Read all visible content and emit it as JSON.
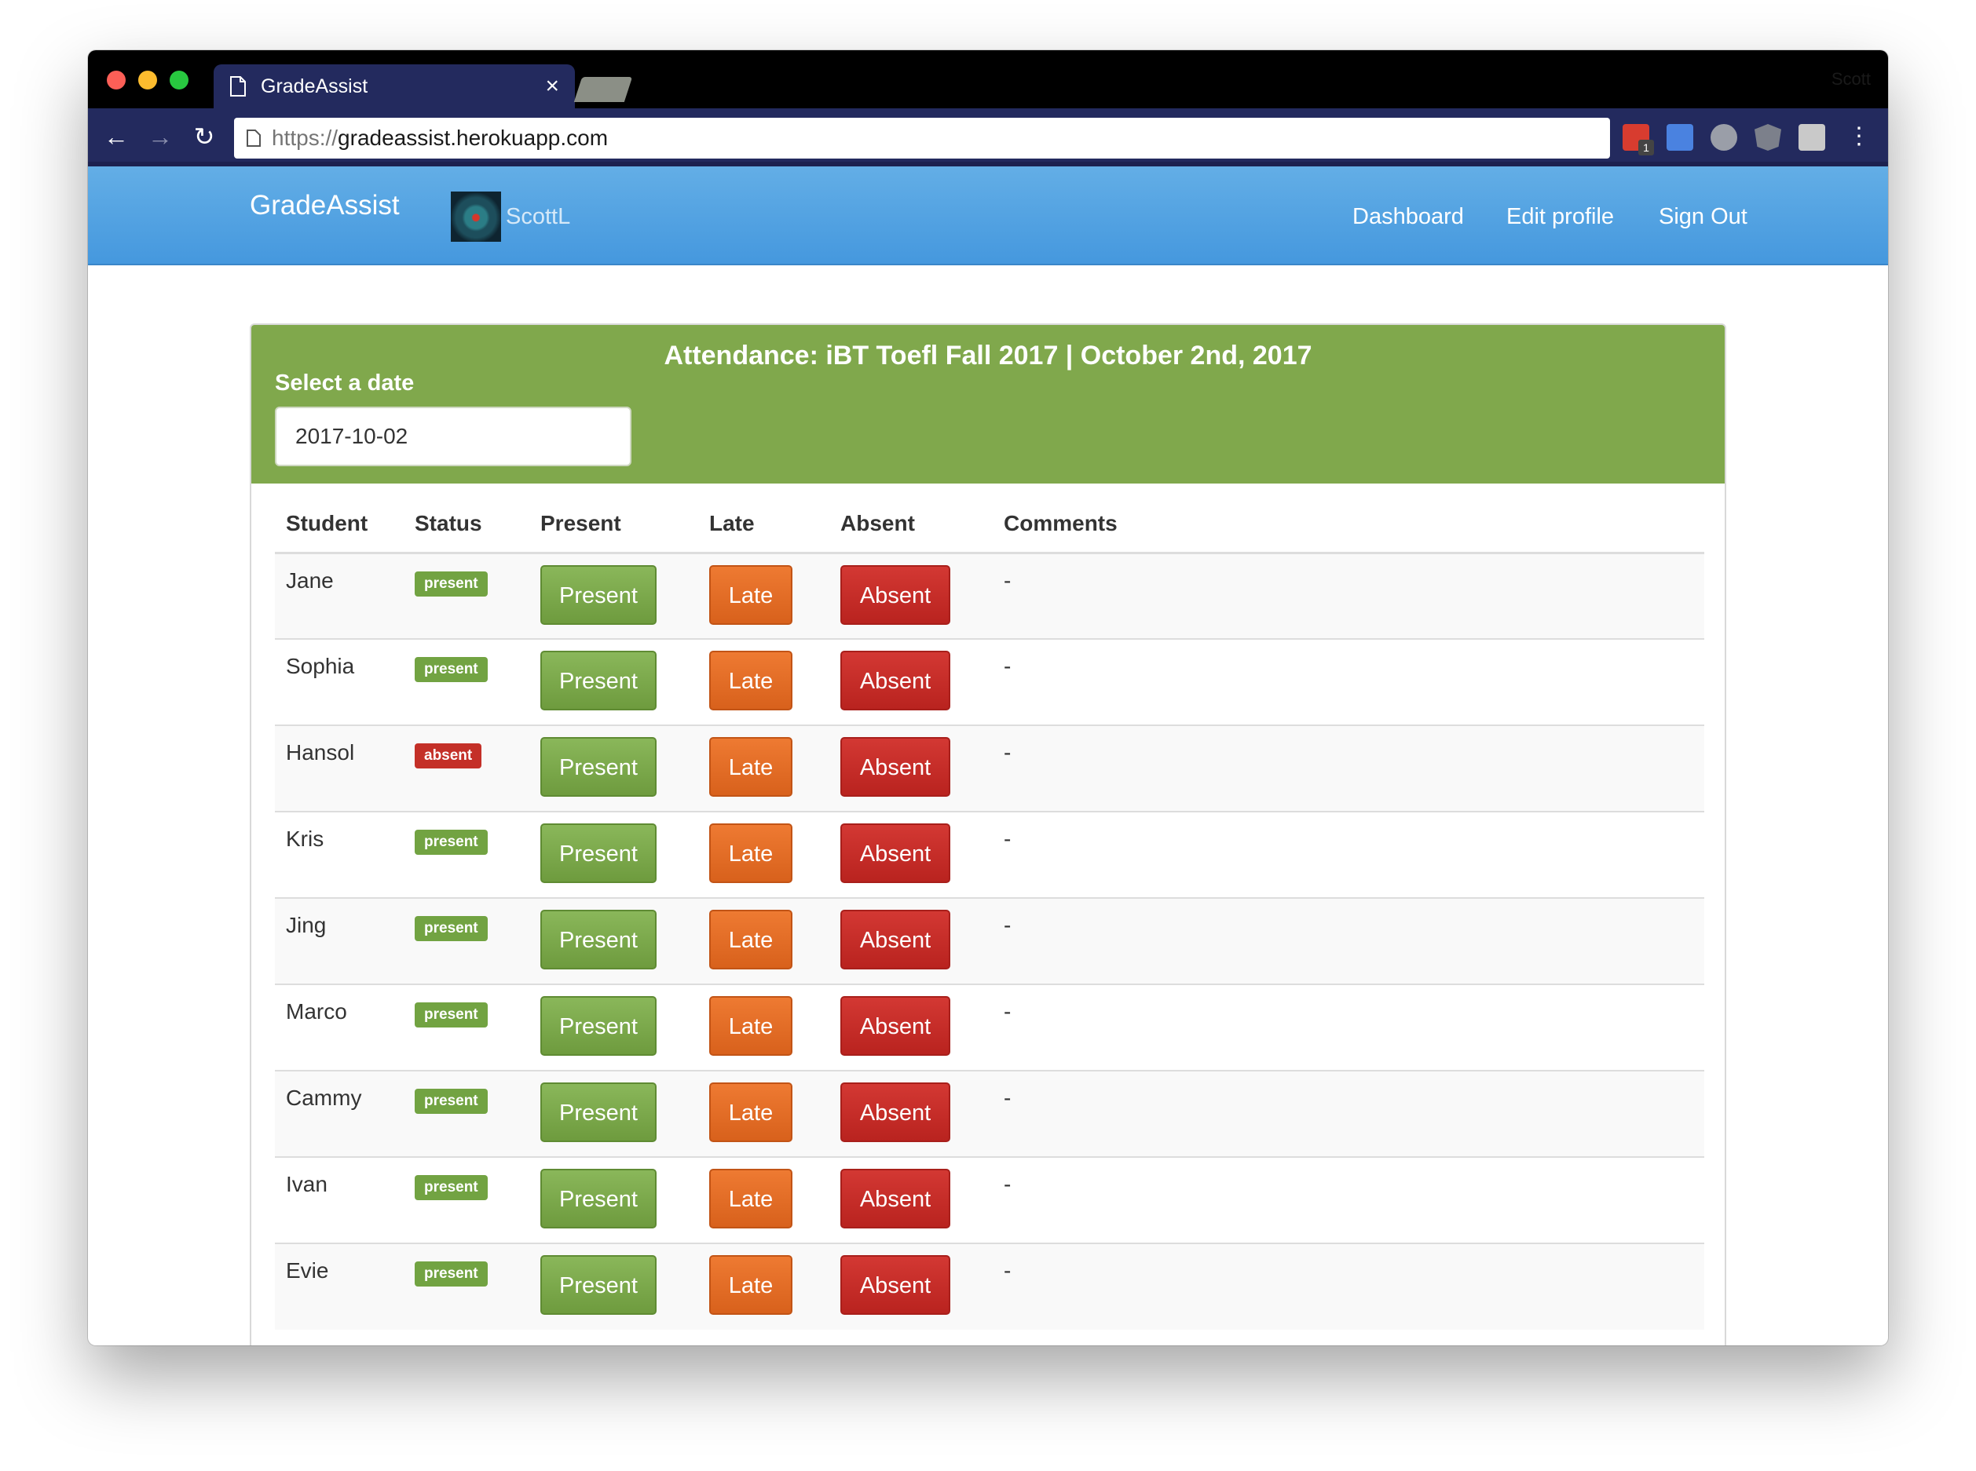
{
  "browser": {
    "tab_title": "GradeAssist",
    "tab_close": "×",
    "profile_name": "Scott",
    "url_scheme": "https://",
    "url_host": "gradeassist.herokuapp.com",
    "back_icon": "←",
    "forward_icon": "→",
    "reload_icon": "↻",
    "menu_icon": "⋮",
    "extension_badge": "1"
  },
  "navbar": {
    "brand": "GradeAssist",
    "username": "ScottL",
    "links": {
      "dashboard": "Dashboard",
      "edit_profile": "Edit profile",
      "sign_out": "Sign Out"
    },
    "gradient_top": "#63aee6",
    "gradient_bottom": "#4598de"
  },
  "attendance": {
    "title": "Attendance: iBT Toefl Fall 2017 | October 2nd, 2017",
    "date_label": "Select a date",
    "date_value": "2017-10-02",
    "header_color": "#80a84c",
    "columns": [
      "Student",
      "Status",
      "Present",
      "Late",
      "Absent",
      "Comments"
    ],
    "buttons": {
      "present": "Present",
      "late": "Late",
      "absent": "Absent"
    },
    "students": [
      {
        "name": "Jane",
        "status": "present",
        "comments": "-"
      },
      {
        "name": "Sophia",
        "status": "present",
        "comments": "-"
      },
      {
        "name": "Hansol",
        "status": "absent",
        "comments": "-"
      },
      {
        "name": "Kris",
        "status": "present",
        "comments": "-"
      },
      {
        "name": "Jing",
        "status": "present",
        "comments": "-"
      },
      {
        "name": "Marco",
        "status": "present",
        "comments": "-"
      },
      {
        "name": "Cammy",
        "status": "present",
        "comments": "-"
      },
      {
        "name": "Ivan",
        "status": "present",
        "comments": "-"
      },
      {
        "name": "Evie",
        "status": "present",
        "comments": "-"
      }
    ]
  },
  "colors": {
    "present": "#72a342",
    "late": "#e06d26",
    "absent": "#c43028"
  }
}
